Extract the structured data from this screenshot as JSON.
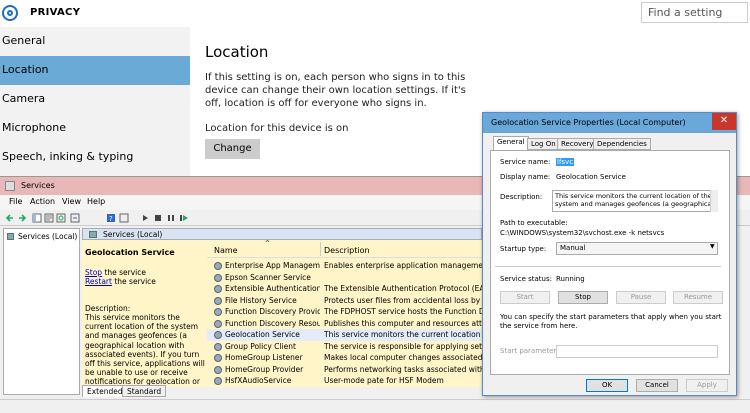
{
  "settings": {
    "app_title": "PRIVACY",
    "search_placeholder": "Find a setting",
    "nav": [
      "General",
      "Location",
      "Camera",
      "Microphone",
      "Speech, inking & typing"
    ],
    "selected_nav": "Location",
    "heading": "Location",
    "description": "If this setting is on, each person who signs in to this device can change their own location settings. If it's off, location is off for everyone who signs in.",
    "status": "Location for this device is on",
    "change_button": "Change",
    "accent_color": "#6aaad6"
  },
  "services": {
    "title": "Services",
    "menu": [
      "File",
      "Action",
      "View",
      "Help"
    ],
    "tree_item": "Services (Local)",
    "pane_title": "Services (Local)",
    "extended": {
      "service_name": "Geolocation Service",
      "stop_link": "Stop",
      "stop_suffix": " the service",
      "restart_link": "Restart",
      "restart_suffix": " the service",
      "description_label": "Description:",
      "description": "This service monitors the current location of the system and manages geofences (a geographical location with associated events).  If you turn off this service, applications will be unable to use or receive notifications for geolocation or geofences."
    },
    "columns": {
      "name": "Name",
      "description": "Description"
    },
    "rows": [
      {
        "name": "Enterprise App Managemen...",
        "description": "Enables enterprise application management."
      },
      {
        "name": "Epson Scanner Service",
        "description": ""
      },
      {
        "name": "Extensible Authentication P...",
        "description": "The Extensible Authentication Protocol (EAP) service"
      },
      {
        "name": "File History Service",
        "description": "Protects user files from accidental loss by copying"
      },
      {
        "name": "Function Discovery Provide...",
        "description": "The FDPHOST service hosts the Function Discove"
      },
      {
        "name": "Function Discovery Resourc...",
        "description": "Publishes this computer and resources attached t"
      },
      {
        "name": "Geolocation Service",
        "description": "This service monitors the current location of the"
      },
      {
        "name": "Group Policy Client",
        "description": "The service is responsible for applying settings c"
      },
      {
        "name": "HomeGroup Listener",
        "description": "Makes local computer changes associated with c"
      },
      {
        "name": "HomeGroup Provider",
        "description": "Performs networking tasks associated with config"
      },
      {
        "name": "HsfXAudioService",
        "description": "User-mode pate for HSF Modem"
      }
    ],
    "tabs": [
      "Extended",
      "Standard"
    ]
  },
  "dialog": {
    "title": "Geolocation Service Properties (Local Computer)",
    "close": "✕",
    "tabs": [
      "General",
      "Log On",
      "Recovery",
      "Dependencies"
    ],
    "service_name_label": "Service name:",
    "service_name": "lfsvc",
    "display_name_label": "Display name:",
    "display_name": "Geolocation Service",
    "description_label": "Description:",
    "description": "This service monitors the current location of the system and manages geofences (a geographical",
    "path_label": "Path to executable:",
    "path": "C:\\WINDOWS\\system32\\svchost.exe -k netsvcs",
    "startup_label": "Startup type:",
    "startup_value": "Manual",
    "status_label": "Service status:",
    "status_value": "Running",
    "buttons": {
      "start": "Start",
      "stop": "Stop",
      "pause": "Pause",
      "resume": "Resume"
    },
    "hint": "You can specify the start parameters that apply when you start the service from here.",
    "params_label": "Start parameters:",
    "ok": "OK",
    "cancel": "Cancel",
    "apply": "Apply"
  }
}
